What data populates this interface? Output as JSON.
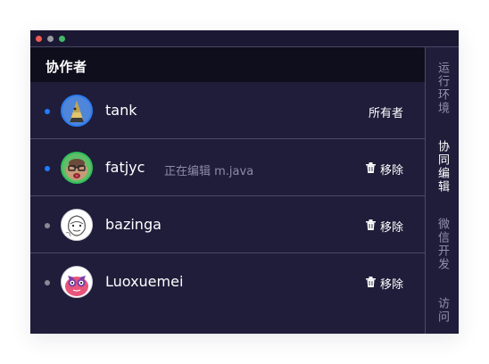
{
  "window": {
    "traffic_lights": [
      "#ed5b52",
      "#9a9aa2",
      "#44b86a"
    ]
  },
  "panel": {
    "title": "协作者"
  },
  "collaborators": [
    {
      "name": "tank",
      "status_color": "#1f7cff",
      "online": true,
      "avatar": "tank-avatar",
      "action_label": "所有者",
      "editing": ""
    },
    {
      "name": "fatjyc",
      "status_color": "#1f7cff",
      "online": true,
      "avatar": "fatjyc-avatar",
      "action_label": "移除",
      "editing": "正在编辑 m.java"
    },
    {
      "name": "bazinga",
      "status_color": "#8a8a96",
      "online": false,
      "avatar": "bazinga-avatar",
      "action_label": "移除",
      "editing": ""
    },
    {
      "name": "Luoxuemei",
      "status_color": "#8a8a96",
      "online": false,
      "avatar": "luoxuemei-avatar",
      "action_label": "移除",
      "editing": ""
    }
  ],
  "sidebar": {
    "tabs": [
      {
        "label": "运行环境",
        "active": false
      },
      {
        "label": "协同编辑",
        "active": true
      },
      {
        "label": "微信开发",
        "active": false
      },
      {
        "label": "访问链接",
        "active": false
      }
    ]
  },
  "icons": {
    "remove": "trash-icon"
  }
}
